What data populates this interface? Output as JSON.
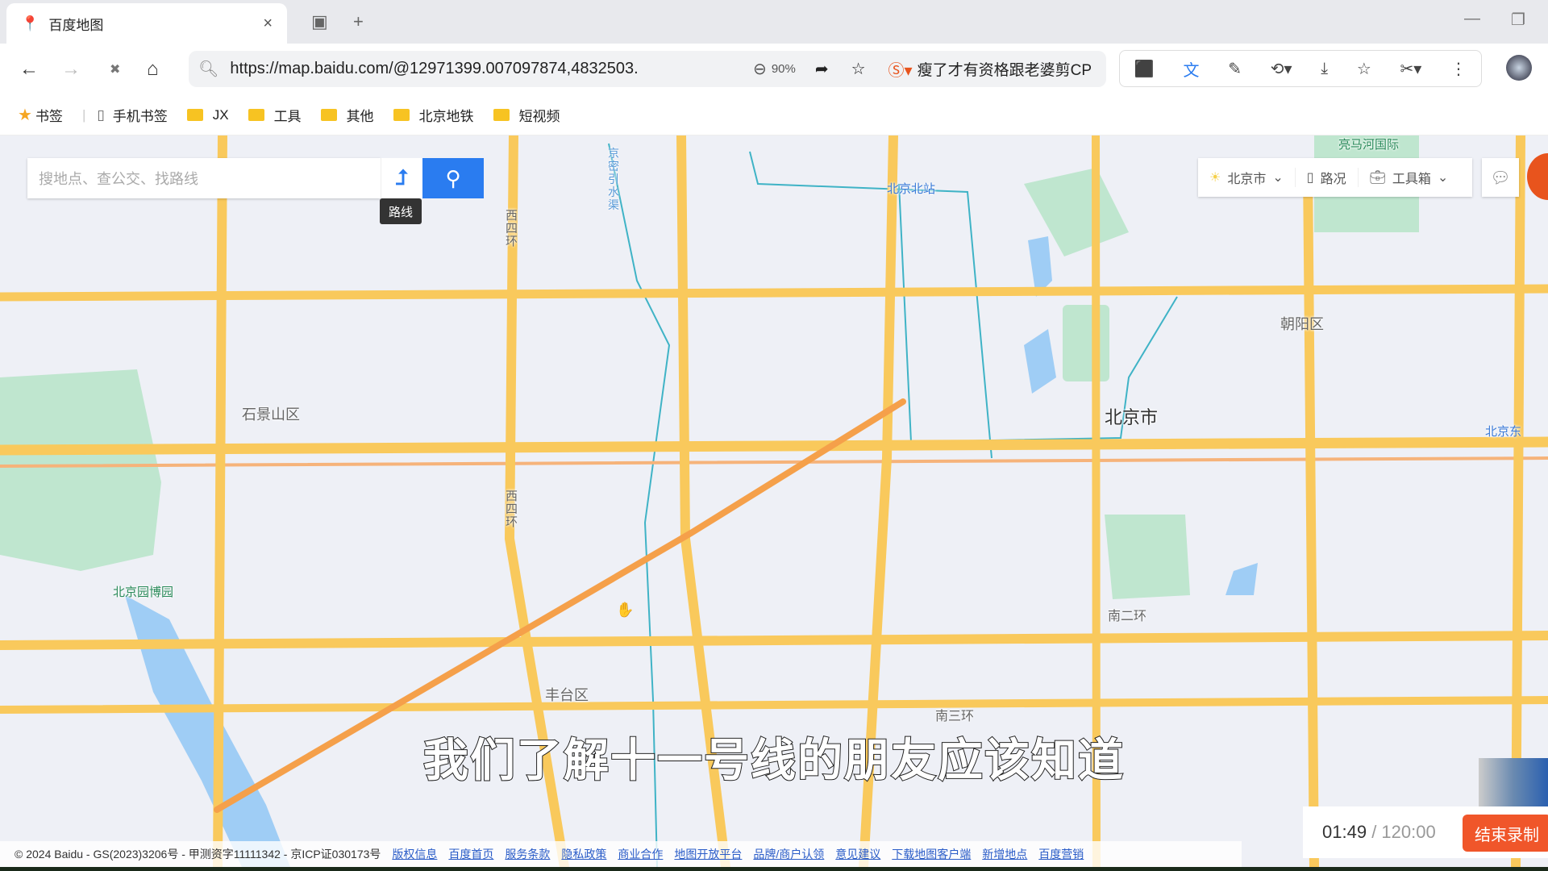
{
  "browser": {
    "tab_title": "百度地图",
    "tab_close": "×",
    "new_tab": "+",
    "url": "https://map.baidu.com/@12971399.007097874,4832503.",
    "zoom": "90%",
    "search_engine_text": "瘦了才有资格跟老婆剪CP",
    "bookmarks": [
      "书签",
      "手机书签",
      "JX",
      "工具",
      "其他",
      "北京地铁",
      "短视频"
    ]
  },
  "map": {
    "search_placeholder": "搜地点、查公交、找路线",
    "route_tooltip": "路线",
    "city": "北京市",
    "traffic": "路况",
    "toolbox": "工具箱",
    "labels": {
      "shijingshan": "石景山区",
      "beijing": "北京市",
      "chaoyang": "朝阳区",
      "fengtai": "丰台区",
      "nan2huan": "南二环",
      "nan3huan": "南三环",
      "beijingbei": "北京北站",
      "yuanboyuan": "北京园博园",
      "liangmahe": "亮马河国际",
      "beijingdong": "北京东",
      "xisihuan1": "西四环",
      "xisihuan2": "西四环",
      "jingmi": "京密引水渠"
    },
    "colors": {
      "road": "#f9c95c",
      "arterial": "#f5a04a",
      "water": "#9fcdf5",
      "park": "#bfe6cf",
      "metro": "#3fb3c6",
      "accent": "#2a7cf0"
    }
  },
  "subtitle": "我们了解十一号线的朋友应该知道",
  "footer": {
    "copyright": "© 2024 Baidu - GS(2023)3206号 - 甲测资字11111342 - 京ICP证030173号",
    "links": [
      "版权信息",
      "百度首页",
      "服务条款",
      "隐私政策",
      "商业合作",
      "地图开放平台",
      "品牌/商户认领",
      "意见建议",
      "下载地图客户端",
      "新增地点",
      "百度营销"
    ]
  },
  "recorder": {
    "elapsed": "01:49",
    "total": "/ 120:00",
    "stop_label": "结束录制"
  }
}
